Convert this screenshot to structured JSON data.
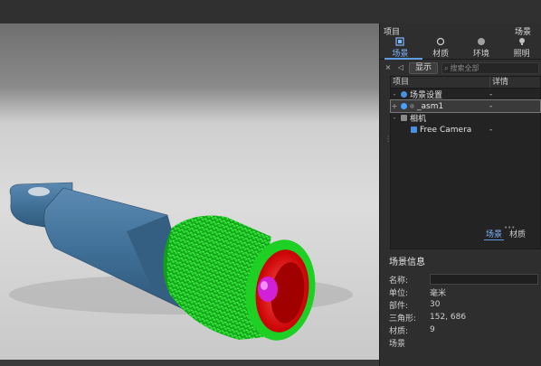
{
  "panel": {
    "title_left": "项目",
    "title_right": "场景",
    "tabs": [
      {
        "label": "场景",
        "icon": "scene-icon",
        "active": true
      },
      {
        "label": "材质",
        "icon": "material-icon",
        "active": false
      },
      {
        "label": "环境",
        "icon": "environment-icon",
        "active": false
      },
      {
        "label": "照明",
        "icon": "lighting-icon",
        "active": false
      }
    ],
    "toolbar": {
      "show_label": "显示",
      "search_placeholder": "搜索全部"
    },
    "tree": {
      "col_item": "项目",
      "col_detail": "详情",
      "rows": [
        {
          "label": "场景设置",
          "detail": "-",
          "expand": "-"
        },
        {
          "label": "_asm1",
          "detail": "-",
          "expand": "+"
        },
        {
          "label": "相机",
          "detail": "",
          "expand": "-"
        },
        {
          "label": "Free Camera",
          "detail": "-",
          "expand": ""
        }
      ]
    },
    "bottom_tabs": [
      "场景",
      "材质"
    ],
    "info": {
      "title": "场景信息",
      "rows": [
        {
          "key": "名称:",
          "value": ""
        },
        {
          "key": "单位:",
          "value": "毫米"
        },
        {
          "key": "部件:",
          "value": "30"
        },
        {
          "key": "三角形:",
          "value": "152, 686"
        },
        {
          "key": "材质:",
          "value": "9"
        },
        {
          "key": "场景",
          "value": ""
        }
      ]
    }
  },
  "colors": {
    "accent": "#5e9be0",
    "grip_green": "#22e02a",
    "body_blue": "#3f6f96",
    "inner_red": "#e01010",
    "tip_magenta": "#d020d8"
  }
}
